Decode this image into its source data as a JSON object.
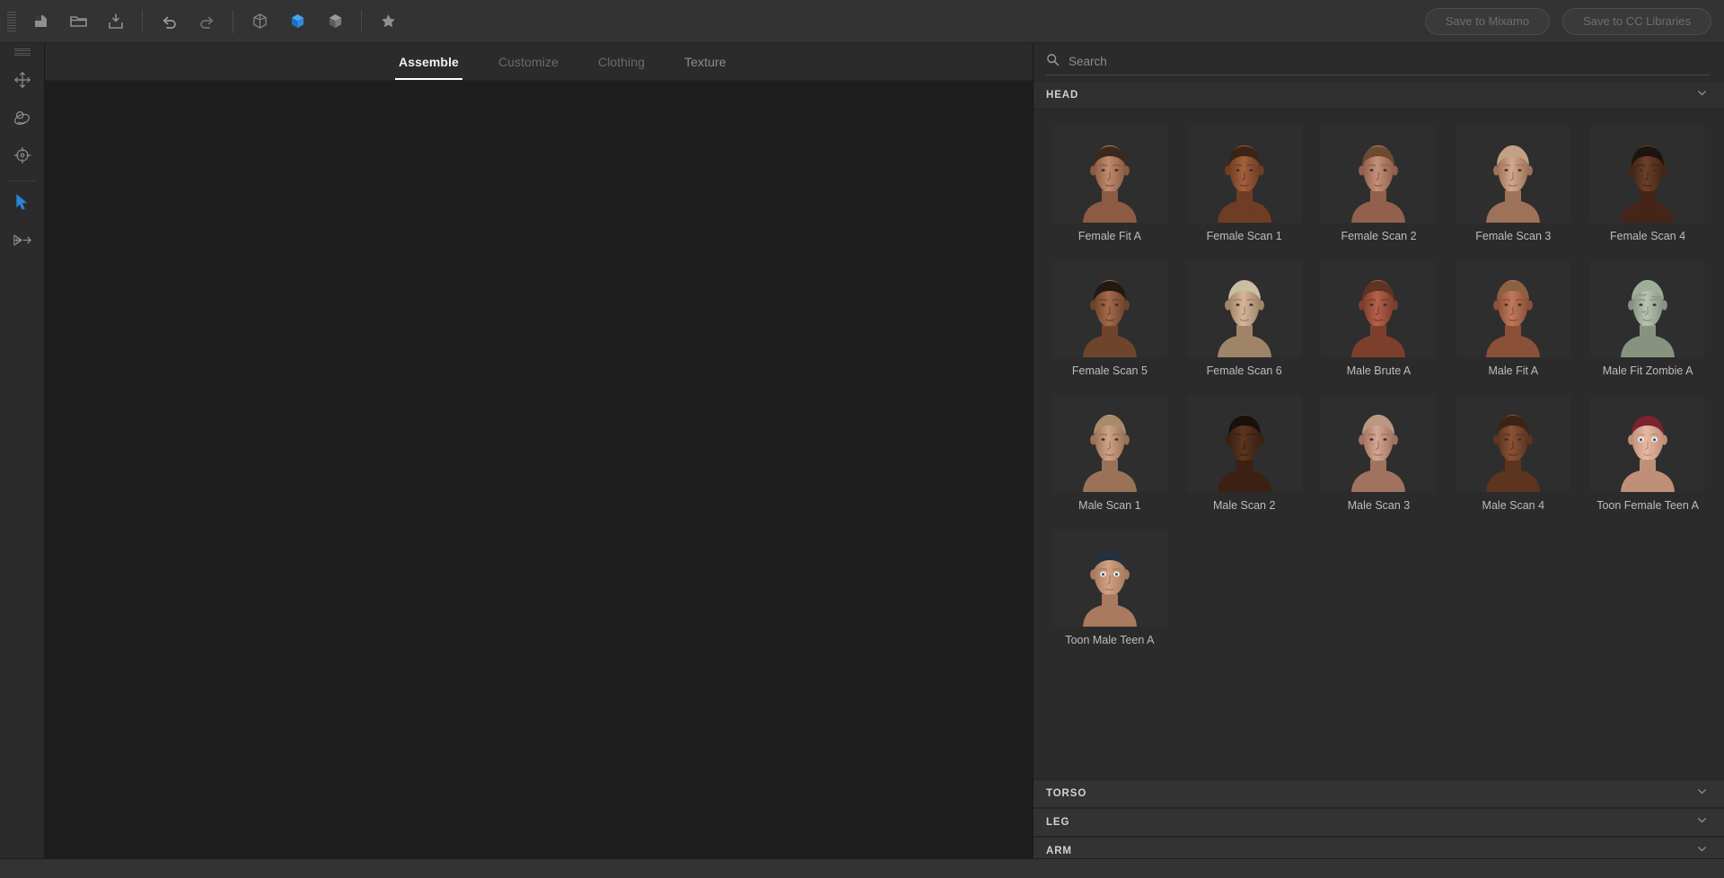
{
  "toolbar": {
    "grip_name": "toolbar-drag-grip",
    "buttons": [
      {
        "name": "new-scene-button",
        "icon": "new-document-icon",
        "label": "New"
      },
      {
        "name": "open-file-button",
        "icon": "folder-open-icon",
        "label": "Open"
      },
      {
        "name": "import-button",
        "icon": "import-icon",
        "label": "Import"
      },
      {
        "name": "undo-button",
        "icon": "undo-arrow-icon",
        "label": "Undo"
      },
      {
        "name": "redo-button",
        "icon": "redo-arrow-icon",
        "label": "Redo"
      },
      {
        "name": "view-wireframe-button",
        "icon": "cube-wireframe-icon",
        "label": "Wireframe"
      },
      {
        "name": "view-solid-button",
        "icon": "cube-solid-icon",
        "label": "Solid"
      },
      {
        "name": "view-shaded-button",
        "icon": "cube-shaded-icon",
        "label": "Shaded"
      },
      {
        "name": "favorites-button",
        "icon": "star-icon",
        "label": "Favorites"
      }
    ],
    "save_mixamo_label": "Save to Mixamo",
    "save_cclibraries_label": "Save to CC Libraries"
  },
  "rail": {
    "items": [
      {
        "name": "pan-tool",
        "icon": "move-arrows-icon",
        "label": "Pan",
        "active": false
      },
      {
        "name": "orbit-tool",
        "icon": "orbit-icon",
        "label": "Orbit",
        "active": false
      },
      {
        "name": "focus-tool",
        "icon": "target-icon",
        "label": "Focus",
        "active": false
      },
      {
        "name": "select-tool",
        "icon": "cursor-arrow-icon",
        "label": "Select",
        "active": true
      },
      {
        "name": "mirror-tool",
        "icon": "mirror-flip-icon",
        "label": "Mirror",
        "active": false
      }
    ]
  },
  "tabs": [
    {
      "label": "Assemble",
      "state": "active"
    },
    {
      "label": "Customize",
      "state": "disabled"
    },
    {
      "label": "Clothing",
      "state": "disabled"
    },
    {
      "label": "Texture",
      "state": "normal"
    }
  ],
  "search": {
    "placeholder": "Search",
    "value": "",
    "icon": "search-icon"
  },
  "sections": [
    {
      "title": "HEAD",
      "expanded": true,
      "chevron": "chevron-down-icon",
      "items": [
        {
          "label": "Female Fit A",
          "skin": "#c08a6e",
          "skin_dark": "#8d5b44",
          "hair": "#3a2a1d",
          "type": "female"
        },
        {
          "label": "Female Scan 1",
          "skin": "#a4603c",
          "skin_dark": "#6f3d24",
          "hair": "#3b2415",
          "type": "female"
        },
        {
          "label": "Female Scan 2",
          "skin": "#c59079",
          "skin_dark": "#92604c",
          "hair": "#6b4a30",
          "type": "female"
        },
        {
          "label": "Female Scan 3",
          "skin": "#d2a88f",
          "skin_dark": "#9d7258",
          "hair": "#c3a283",
          "type": "female"
        },
        {
          "label": "Female Scan 4",
          "skin": "#6b4026",
          "skin_dark": "#452517",
          "hair": "#1d1410",
          "type": "female"
        },
        {
          "label": "Female Scan 5",
          "skin": "#a46a4a",
          "skin_dark": "#6f442c",
          "hair": "#241812",
          "type": "female"
        },
        {
          "label": "Female Scan 6",
          "skin": "#d6b69b",
          "skin_dark": "#a08468",
          "hair": "#c9bfa3",
          "type": "female"
        },
        {
          "label": "Male Brute A",
          "skin": "#b4614a",
          "skin_dark": "#7e3e2c",
          "hair": "#5e3422",
          "type": "male"
        },
        {
          "label": "Male Fit A",
          "skin": "#c07a5c",
          "skin_dark": "#8b5038",
          "hair": "#8a6141",
          "type": "male"
        },
        {
          "label": "Male Fit Zombie A",
          "skin": "#b9c4b4",
          "skin_dark": "#87937f",
          "hair": "#9fae97",
          "type": "zombie"
        },
        {
          "label": "Male Scan 1",
          "skin": "#cfa389",
          "skin_dark": "#9a7257",
          "hair": "#a98b6b",
          "type": "male"
        },
        {
          "label": "Male Scan 2",
          "skin": "#5d3620",
          "skin_dark": "#3b2013",
          "hair": "#18100b",
          "type": "male"
        },
        {
          "label": "Male Scan 3",
          "skin": "#d5a693",
          "skin_dark": "#a1735f",
          "hair": "#b79880",
          "type": "male"
        },
        {
          "label": "Male Scan 4",
          "skin": "#8a5334",
          "skin_dark": "#5c3420",
          "hair": "#3b2415",
          "type": "male"
        },
        {
          "label": "Toon Female Teen A",
          "skin": "#e6b9a3",
          "skin_dark": "#c08f78",
          "hair": "#7a2230",
          "type": "toon-f"
        },
        {
          "label": "Toon Male Teen A",
          "skin": "#d3a183",
          "skin_dark": "#a97a5e",
          "hair": "#24303f",
          "type": "toon-m"
        }
      ]
    },
    {
      "title": "TORSO",
      "expanded": false,
      "chevron": "chevron-down-icon",
      "items": []
    },
    {
      "title": "LEG",
      "expanded": false,
      "chevron": "chevron-down-icon",
      "items": []
    },
    {
      "title": "ARM",
      "expanded": false,
      "chevron": "chevron-down-icon",
      "items": []
    }
  ],
  "colors": {
    "accent_blue": "#2e86d8",
    "toolbar_bg": "#333333",
    "panel_bg": "#2b2b2b",
    "viewport_bg": "#1e1e1e",
    "text_primary": "#e6e6e6",
    "text_muted": "#8d8d8d"
  }
}
